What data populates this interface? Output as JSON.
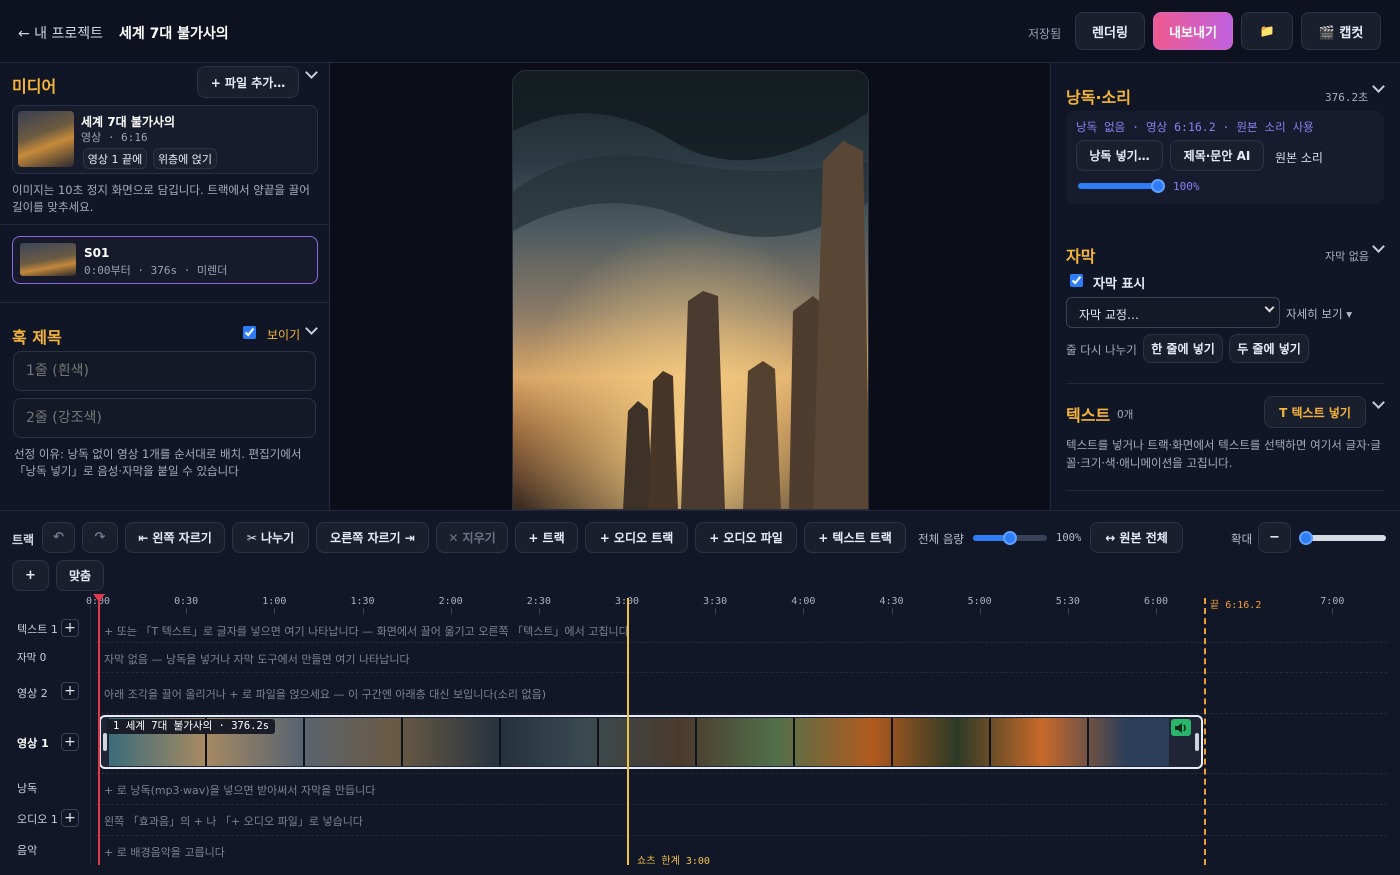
{
  "topbar": {
    "back_label": "← 내 프로젝트",
    "project_title": "세계 7대 불가사의",
    "saved": "저장됨",
    "render": "렌더링",
    "export": "내보내기",
    "folder_icon": "📁",
    "capcut": "🎬 캡컷"
  },
  "media": {
    "title": "미디어",
    "add_file": "+ 파일 추가…",
    "item_title": "세계 7대 불가사의",
    "item_meta_type": "영상",
    "item_meta_dur": "6:16",
    "btn_end": "영상 1 끝에",
    "btn_top": "위층에 얹기",
    "note": "이미지는 10초 정지 화면으로 담깁니다. 트랙에서 양끝을 끌어 길이를 맞추세요.",
    "scene_name": "S01",
    "scene_start": "0:00부터",
    "scene_len": "376s",
    "scene_status": "미렌더"
  },
  "hook": {
    "title": "훅 제목",
    "show_label": "보이기",
    "line1_placeholder": "1줄 (흰색)",
    "line2_placeholder": "2줄 (강조색)",
    "reason": "선정 이유: 낭독 없이 영상 1개를 순서대로 배치. 편집기에서 「낭독 넣기」로 음성·자막을 붙일 수 있습니다"
  },
  "narration": {
    "title": "낭독·소리",
    "length": "376.2초",
    "status": "낭독 없음 · 영상 6:16.2 · 원본 소리 사용",
    "btn_add": "낭독 넣기…",
    "btn_ai": "제목·문안 AI",
    "orig_sound": "원본 소리",
    "volume": "100%",
    "volume_fraction": 1.0
  },
  "subtitle": {
    "title": "자막",
    "status": "자막 없음",
    "show_label": "자막 표시",
    "select_value": "자막 교정…",
    "detail": "자세히 보기 ▾",
    "rewrap": "줄 다시 나누기",
    "one_line": "한 줄에 넣기",
    "two_line": "두 줄에 넣기"
  },
  "text_panel": {
    "title": "텍스트",
    "count": "0개",
    "add_btn": "T 텍스트 넣기",
    "desc": "텍스트를 넣거나 트랙·화면에서 텍스트를 선택하면 여기서 글자·글꼴·크기·색·애니메이션을 고칩니다."
  },
  "toolbar": {
    "track_label": "트랙",
    "undo": "↶",
    "redo": "↷",
    "trim_left": "⇤ 왼쪽 자르기",
    "split": "✂ 나누기",
    "trim_right": "오른쪽 자르기 ⇥",
    "delete": "✕ 지우기",
    "add_track": "+ 트랙",
    "add_audio_track": "+ 오디오 트랙",
    "add_audio_file": "+ 오디오 파일",
    "add_text_track": "+ 텍스트 트랙",
    "master_volume_label": "전체 음량",
    "master_volume": "100%",
    "master_volume_fraction": 0.5,
    "original_all": "↔ 원본 전체",
    "zoom_label": "확대",
    "zoom_minus": "−",
    "zoom_plus": "+",
    "fit": "맞춤",
    "zoom_fraction": 0.0
  },
  "timeline": {
    "ticks": [
      "0:00",
      "0:30",
      "1:00",
      "1:30",
      "2:00",
      "2:30",
      "3:00",
      "3:30",
      "4:00",
      "4:30",
      "5:00",
      "5:30",
      "6:00",
      "7:00"
    ],
    "end_marker": "끝 6:16.2",
    "shorts_limit": "쇼츠 한계 3:00",
    "rows": {
      "text1": "텍스트 1",
      "subtitle": "자막 0",
      "video2": "영상 2",
      "video1": "영상 1",
      "narration": "낭독",
      "audio1": "오디오 1",
      "music": "음악"
    },
    "hints": {
      "text1": "+ 또는 「T 텍스트」로 글자를 넣으면 여기 나타납니다 — 화면에서 끌어 옮기고 오른쪽 「텍스트」에서 고칩니다",
      "subtitle": "자막 없음 — 낭독을 넣거나 자막 도구에서 만들면 여기 나타납니다",
      "video2": "아래 조각을 끌어 올리거나 + 로 파일을 얹으세요 — 이 구간엔 아래층 대신 보입니다(소리 없음)",
      "narration": "+ 로 낭독(mp3·wav)을 넣으면 받아써서 자막을 만듭니다",
      "audio1": "왼쪽 「효과음」의 + 나 「+ 오디오 파일」로 넣습니다",
      "music": "+ 로 배경음악을 고릅니다"
    },
    "clip_label": "1  세계 7대 불가사의  · 376.2s",
    "clip_speaker_icon": "speaker-icon",
    "clip_end_seconds": 376.2,
    "playhead_seconds": 0,
    "limit_seconds": 180
  }
}
